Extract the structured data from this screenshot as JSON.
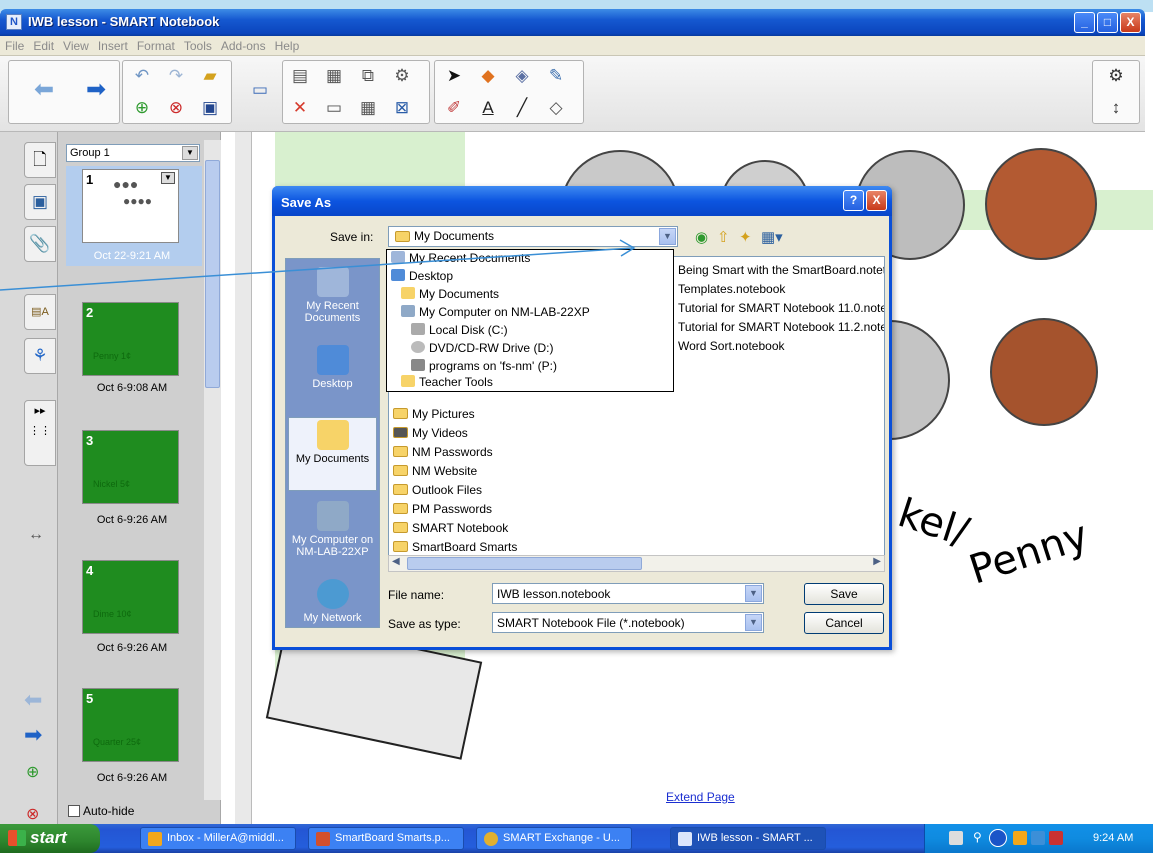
{
  "window": {
    "title": "IWB lesson - SMART Notebook",
    "min": "_",
    "max": "□",
    "close": "X"
  },
  "menu": [
    "File",
    "Edit",
    "View",
    "Insert",
    "Format",
    "Tools",
    "Add-ons",
    "Help"
  ],
  "sorter": {
    "group": "Group 1",
    "pages": [
      {
        "num": "1",
        "label": "Oct 22-9:21 AM",
        "mini": ""
      },
      {
        "num": "2",
        "label": "Oct 6-9:08 AM",
        "mini": "Penny   1¢"
      },
      {
        "num": "3",
        "label": "Oct 6-9:26 AM",
        "mini": "Nickel   5¢"
      },
      {
        "num": "4",
        "label": "Oct 6-9:26 AM",
        "mini": "Dime   10¢"
      },
      {
        "num": "5",
        "label": "Oct 6-9:26 AM",
        "mini": "Quarter   25¢"
      }
    ],
    "autohide": "Auto-hide"
  },
  "canvas": {
    "handwriting1": "kel/",
    "handwriting2": "Penny",
    "extend": "Extend Page"
  },
  "dialog": {
    "title": "Save As",
    "help": "?",
    "close": "X",
    "save_in_label": "Save in:",
    "save_in_value": "My Documents",
    "places": [
      "My Recent Documents",
      "Desktop",
      "My Documents",
      "My Computer on NM-LAB-22XP",
      "My Network"
    ],
    "dropdown": [
      "My Recent Documents",
      "Desktop",
      "My Documents",
      "My Computer on NM-LAB-22XP",
      "Local Disk (C:)",
      "DVD/CD-RW Drive (D:)",
      "programs on 'fs-nm' (P:)",
      "Teacher Tools"
    ],
    "folders": [
      "My Pictures",
      "My Videos",
      "NM Passwords",
      "NM Website",
      "Outlook Files",
      "PM Passwords",
      "SMART Notebook",
      "SmartBoard Smarts"
    ],
    "files": [
      "Being Smart with the SmartBoard.notet",
      "Templates.notebook",
      "Tutorial for SMART Notebook 11.0.note",
      "Tutorial for SMART Notebook 11.2.note",
      "Word Sort.notebook"
    ],
    "file_name_label": "File name:",
    "file_name": "IWB lesson.notebook",
    "save_type_label": "Save as type:",
    "save_type": "SMART Notebook File (*.notebook)",
    "save_btn": "Save",
    "cancel_btn": "Cancel"
  },
  "taskbar": {
    "start": "start",
    "tasks": [
      "Inbox - MillerA@middl...",
      "SmartBoard Smarts.p...",
      "SMART Exchange - U...",
      "IWB lesson - SMART ..."
    ],
    "time": "9:24 AM"
  }
}
